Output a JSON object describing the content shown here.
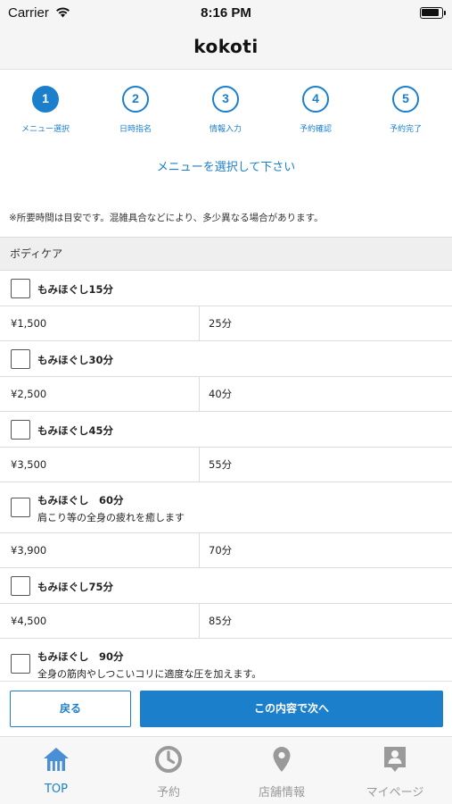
{
  "status_bar": {
    "carrier": "Carrier",
    "time": "8:16 PM"
  },
  "header": {
    "title": "kokoti"
  },
  "steps": [
    {
      "number": "1",
      "label": "メニュー選択",
      "active": true
    },
    {
      "number": "2",
      "label": "日時指名",
      "active": false
    },
    {
      "number": "3",
      "label": "情報入力",
      "active": false
    },
    {
      "number": "4",
      "label": "予約確認",
      "active": false
    },
    {
      "number": "5",
      "label": "予約完了",
      "active": false
    }
  ],
  "instruction": "メニューを選択して下さい",
  "notice": "※所要時間は目安です。混雑具合などにより、多少異なる場合があります。",
  "category": "ボディケア",
  "menu_items": [
    {
      "name": "もみほぐし15分",
      "description": "",
      "price": "¥1,500",
      "duration": "25分",
      "checked": false
    },
    {
      "name": "もみほぐし30分",
      "description": "",
      "price": "¥2,500",
      "duration": "40分",
      "checked": false
    },
    {
      "name": "もみほぐし45分",
      "description": "",
      "price": "¥3,500",
      "duration": "55分",
      "checked": false
    },
    {
      "name": "もみほぐし　60分",
      "description": "肩こり等の全身の疲れを癒します",
      "price": "¥3,900",
      "duration": "70分",
      "checked": false
    },
    {
      "name": "もみほぐし75分",
      "description": "",
      "price": "¥4,500",
      "duration": "85分",
      "checked": false
    },
    {
      "name": "もみほぐし　90分",
      "description": "全身の筋肉やしつこいコリに適度な圧を加えます。",
      "price": "",
      "duration": "",
      "checked": false
    }
  ],
  "actions": {
    "back_label": "戻る",
    "next_label": "この内容で次へ"
  },
  "tabs": [
    {
      "label": "TOP",
      "icon": "home-icon",
      "active": true
    },
    {
      "label": "予約",
      "icon": "clock-icon",
      "active": false
    },
    {
      "label": "店舗情報",
      "icon": "location-pin-icon",
      "active": false
    },
    {
      "label": "マイページ",
      "icon": "user-badge-icon",
      "active": false
    }
  ],
  "colors": {
    "accent": "#1c7fcc",
    "inactive_tab": "#9a9a9a",
    "category_bg": "#efefef"
  }
}
